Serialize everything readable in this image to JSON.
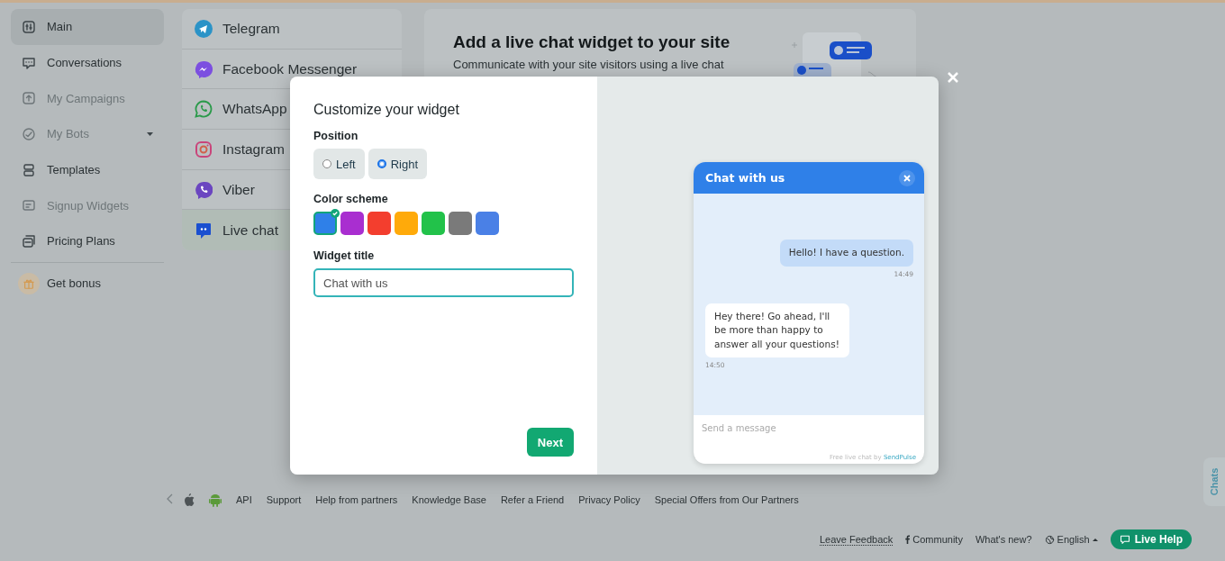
{
  "sidebar": {
    "items": [
      {
        "label": "Main",
        "selected": true,
        "disabled": false,
        "kind": "link"
      },
      {
        "label": "Conversations",
        "selected": false,
        "disabled": false,
        "kind": "link"
      },
      {
        "label": "My Campaigns",
        "selected": false,
        "disabled": true,
        "kind": "link"
      },
      {
        "label": "My Bots",
        "selected": false,
        "disabled": true,
        "kind": "group"
      },
      {
        "label": "Templates",
        "selected": false,
        "disabled": false,
        "kind": "link"
      },
      {
        "label": "Signup Widgets",
        "selected": false,
        "disabled": true,
        "kind": "link"
      },
      {
        "label": "Pricing Plans",
        "selected": false,
        "disabled": false,
        "kind": "link"
      }
    ],
    "bonus": {
      "label": "Get bonus"
    }
  },
  "channels": [
    {
      "label": "Telegram",
      "selected": false
    },
    {
      "label": "Facebook Messenger",
      "selected": false
    },
    {
      "label": "WhatsApp",
      "selected": false
    },
    {
      "label": "Instagram",
      "selected": false
    },
    {
      "label": "Viber",
      "selected": false
    },
    {
      "label": "Live chat",
      "selected": true
    }
  ],
  "card": {
    "title": "Add a live chat widget to your site",
    "text": "Communicate with your site visitors using a live chat"
  },
  "modal": {
    "title": "Customize your widget",
    "position": {
      "label": "Position",
      "options": [
        {
          "label": "Left",
          "selected": false
        },
        {
          "label": "Right",
          "selected": true
        }
      ]
    },
    "color_scheme": {
      "label": "Color scheme",
      "swatches": [
        {
          "color": "#2f80e8",
          "selected": true
        },
        {
          "color": "#a92ed0",
          "selected": false
        },
        {
          "color": "#f33e2e",
          "selected": false
        },
        {
          "color": "#ffaa0a",
          "selected": false
        },
        {
          "color": "#22c24a",
          "selected": false
        },
        {
          "color": "#7a7a7a",
          "selected": false
        },
        {
          "color": "#4a80e6",
          "selected": false
        }
      ]
    },
    "widget_title": {
      "label": "Widget title",
      "value": "Chat with us"
    },
    "next_button": "Next",
    "preview": {
      "title": "Chat with us",
      "messages": [
        {
          "kind": "outgoing",
          "text": "Hello! I have a question.",
          "time": "14:49"
        },
        {
          "kind": "incoming",
          "text": "Hey there! Go ahead, I'll be more than happy to answer all your questions!",
          "time": "14:50"
        }
      ],
      "placeholder": "Send a message",
      "credit": "Free live chat by",
      "credit_link": "SendPulse"
    }
  },
  "footer_links": [
    "API",
    "Support",
    "Help from partners",
    "Knowledge Base",
    "Refer a Friend",
    "Privacy Policy",
    "Special Offers from Our Partners"
  ],
  "bottom_bar": {
    "feedback": "Leave Feedback",
    "community": "Community",
    "whats_new": "What's new?",
    "language": "English",
    "live_help": "Live Help"
  },
  "chats_tab": "Chats"
}
